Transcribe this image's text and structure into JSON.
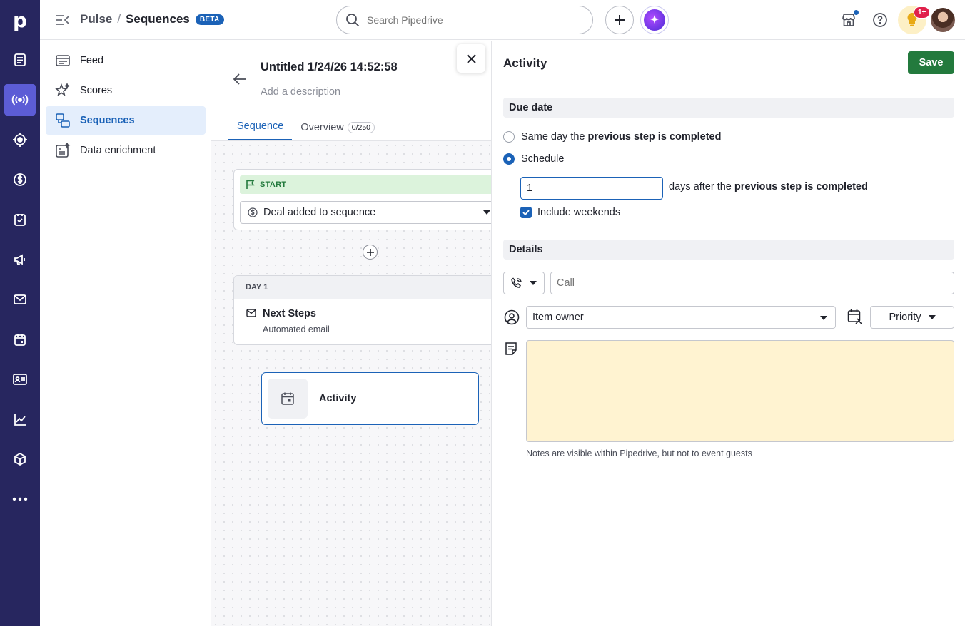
{
  "app": {
    "brand": "p"
  },
  "header": {
    "crumb_parent": "Pulse",
    "crumb_sep": "/",
    "crumb_current": "Sequences",
    "beta_badge": "BETA",
    "search_placeholder": "Search Pipedrive",
    "notif_badge": "1+"
  },
  "subnav": {
    "items": [
      {
        "label": "Feed",
        "icon": "feed-icon"
      },
      {
        "label": "Scores",
        "icon": "stars-icon"
      },
      {
        "label": "Sequences",
        "icon": "sequences-icon"
      },
      {
        "label": "Data enrichment",
        "icon": "enrichment-icon"
      }
    ]
  },
  "sequence": {
    "title": "Untitled 1/24/26 14:52:58",
    "description_placeholder": "Add a description",
    "tabs": [
      {
        "label": "Sequence"
      },
      {
        "label": "Overview",
        "badge": "0/250"
      }
    ],
    "start_label": "START",
    "trigger_value": "Deal added to sequence",
    "day_label": "DAY 1",
    "step_title": "Next Steps",
    "step_subtitle": "Automated email",
    "activity_card_label": "Activity"
  },
  "panel": {
    "title": "Activity",
    "save_label": "Save",
    "due_date_heading": "Due date",
    "option_same_day_prefix": "Same day the ",
    "option_same_day_bold": "previous step is completed",
    "option_schedule": "Schedule",
    "days_value": "1",
    "days_suffix_prefix": "days after the ",
    "days_suffix_bold": "previous step is completed",
    "include_weekends": "Include weekends",
    "details_heading": "Details",
    "subject_placeholder": "Call",
    "owner_value": "Item owner",
    "priority_label": "Priority",
    "notes_hint": "Notes are visible within Pipedrive, but not to event guests"
  },
  "colors": {
    "rail_bg": "#27265f",
    "rail_active": "#5c5cd6",
    "accent_blue": "#1b62b7",
    "save_green": "#237a3d",
    "start_green_bg": "#dcf3dc",
    "notes_bg": "#fff3d1",
    "badge_red": "#e0204a"
  }
}
